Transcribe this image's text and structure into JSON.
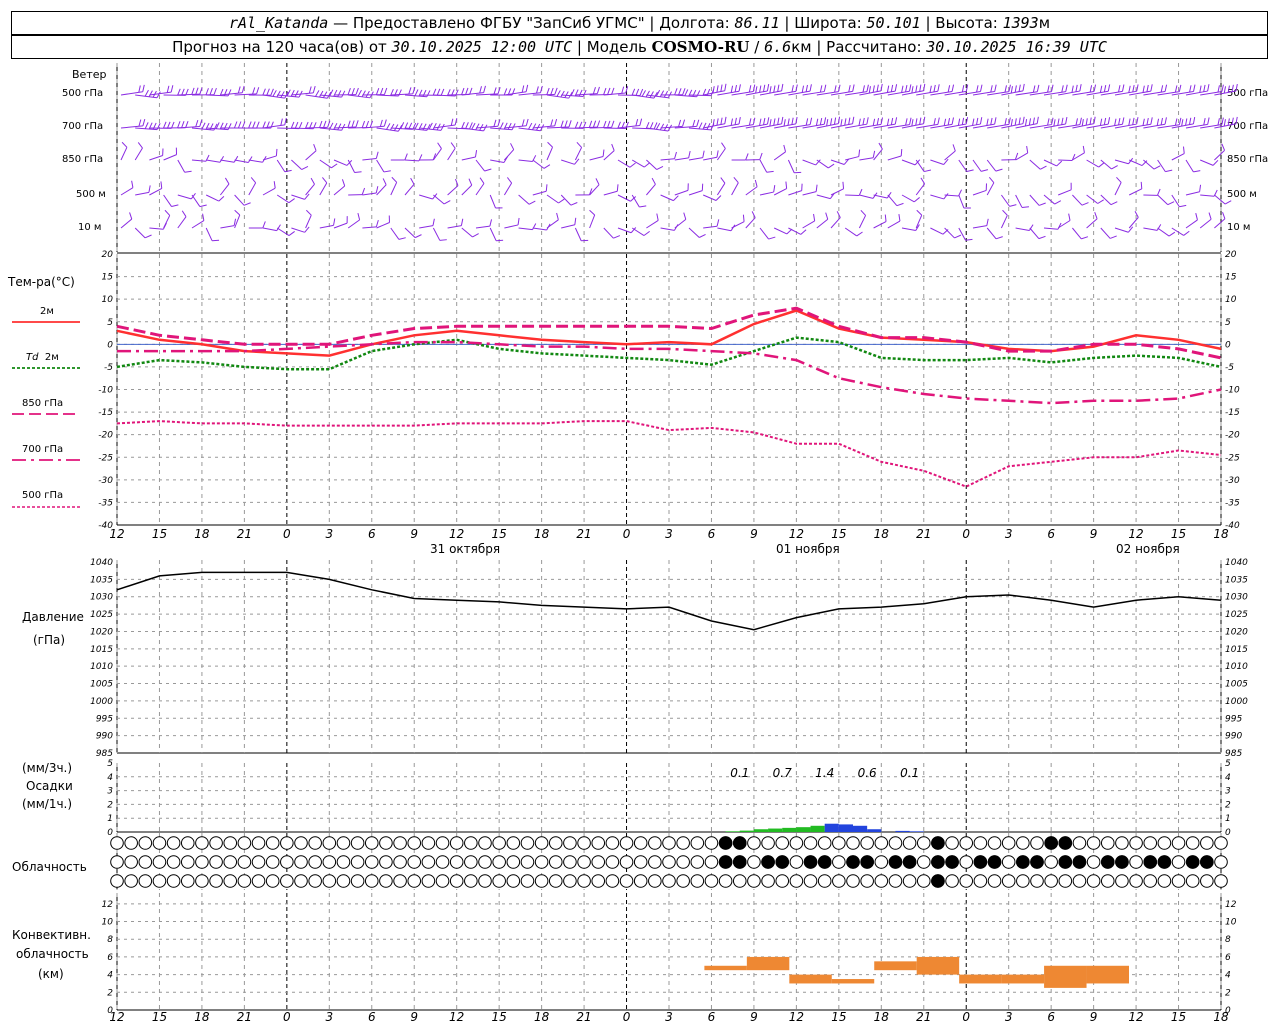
{
  "header": {
    "station": "rAl_Katanda",
    "sep1": " — Предоставлено ФГБУ \"ЗапСиб УГМС\" | Долгота: ",
    "lon": "86.11",
    "sep2": " | Широта: ",
    "lat": "50.101",
    "sep3": " | Высота: ",
    "alt": "1393",
    "alt_unit": "м",
    "line2_a": "Прогноз на 120 часа(ов) от ",
    "issued": "30.10.2025 12:00 UTC",
    "line2_b": "  | Модель ",
    "model": "COSMO-RU",
    "line2_c": " / ",
    "resolution": "6.6",
    "res_unit": "км",
    "line2_d": " | Рассчитано: ",
    "calculated": "30.10.2025 16:39 UTC"
  },
  "colors": {
    "wind": "#8a2be2",
    "t2m": "#ff3030",
    "td2m": "#118811",
    "t850": "#e0157a",
    "t700": "#e0157a",
    "t500": "#e0157a",
    "pressure": "#000000",
    "precip_green": "#22bb22",
    "precip_blue": "#2244dd",
    "convective": "#ee8833",
    "grid": "#999999"
  },
  "labels": {
    "wind": "Ветер",
    "wind_levels": [
      "500 гПа",
      "700 гПа",
      "850 гПа",
      "500 м",
      "10  м"
    ],
    "temp": "Тем-ра(°C)",
    "legend_2m": "2м",
    "legend_td_a": "Td",
    "legend_td_b": "2м",
    "legend_850": "850 гПа",
    "legend_700": "700 гПа",
    "legend_500": "500 гПа",
    "pressure_a": "Давление",
    "pressure_b": "(гПа)",
    "precip_a": "(мм/3ч.)",
    "precip_b": "Осадки",
    "precip_c": "(мм/1ч.)",
    "cloud": "Облачность",
    "conv_a": "Конвективн.",
    "conv_b": "облачность",
    "conv_c": "(км)",
    "dates": [
      "31 октября",
      "01 ноября",
      "02 ноября"
    ]
  },
  "time_axis": {
    "hours_from_start": [
      0,
      3,
      6,
      9,
      12,
      15,
      18,
      21,
      24,
      27,
      30,
      33,
      36,
      39,
      42,
      45,
      48,
      51,
      54,
      57,
      60,
      63,
      66,
      69,
      72,
      75,
      78
    ],
    "tick_labels": [
      "12",
      "15",
      "18",
      "21",
      "0",
      "3",
      "6",
      "9",
      "12",
      "15",
      "18",
      "21",
      "0",
      "3",
      "6",
      "9",
      "12",
      "15",
      "18",
      "21",
      "0",
      "3",
      "6",
      "9",
      "12",
      "15",
      "18"
    ]
  },
  "chart_data": [
    {
      "type": "line",
      "title": "Тем-ра(°C)",
      "x_unit": "hours from 30.10.2025 12:00 UTC",
      "ylim": [
        -40,
        20
      ],
      "yticks": [
        -40,
        -35,
        -30,
        -25,
        -20,
        -15,
        -10,
        -5,
        0,
        5,
        10,
        15,
        20
      ],
      "series": [
        {
          "name": "2м",
          "x": [
            0,
            3,
            6,
            9,
            12,
            15,
            18,
            21,
            24,
            27,
            30,
            33,
            36,
            39,
            42,
            45,
            48,
            51,
            54,
            57,
            60,
            63,
            66,
            69,
            72,
            75,
            78
          ],
          "values": [
            3,
            1,
            0,
            -1.5,
            -2,
            -2.5,
            0,
            2,
            3,
            2,
            1,
            0.5,
            0,
            0.5,
            0,
            4.5,
            7.5,
            3.5,
            1.5,
            1,
            0.5,
            -1,
            -1.5,
            -0.5,
            2,
            1,
            -1
          ]
        },
        {
          "name": "Td 2м",
          "x": [
            0,
            3,
            6,
            9,
            12,
            15,
            18,
            21,
            24,
            27,
            30,
            33,
            36,
            39,
            42,
            45,
            48,
            51,
            54,
            57,
            60,
            63,
            66,
            69,
            72,
            75,
            78
          ],
          "values": [
            -5,
            -3.5,
            -4,
            -5,
            -5.5,
            -5.5,
            -1.5,
            0,
            1,
            -1,
            -2,
            -2.5,
            -3,
            -3.5,
            -4.5,
            -1.5,
            1.5,
            0.5,
            -3,
            -3.5,
            -3.5,
            -3,
            -4,
            -3,
            -2.5,
            -3,
            -5
          ]
        },
        {
          "name": "850 гПа",
          "x": [
            0,
            3,
            6,
            9,
            12,
            15,
            18,
            21,
            24,
            27,
            30,
            33,
            36,
            39,
            42,
            45,
            48,
            51,
            54,
            57,
            60,
            63,
            66,
            69,
            72,
            75,
            78
          ],
          "values": [
            4,
            2,
            1,
            0,
            0,
            0,
            2,
            3.5,
            4,
            4,
            4,
            4,
            4,
            4,
            3.5,
            6.5,
            8,
            4,
            1.5,
            1.5,
            0.5,
            -1.5,
            -1.5,
            0,
            0,
            -1,
            -3
          ]
        },
        {
          "name": "700 гПа",
          "x": [
            0,
            3,
            6,
            9,
            12,
            15,
            18,
            21,
            24,
            27,
            30,
            33,
            36,
            39,
            42,
            45,
            48,
            51,
            54,
            57,
            60,
            63,
            66,
            69,
            72,
            75,
            78
          ],
          "values": [
            -1.5,
            -1.5,
            -1.5,
            -1.5,
            -1,
            -0.5,
            0,
            0.5,
            0.5,
            0,
            -0.5,
            -0.5,
            -1,
            -1,
            -1.5,
            -2,
            -3.5,
            -7.5,
            -9.5,
            -11,
            -12,
            -12.5,
            -13,
            -12.5,
            -12.5,
            -12,
            -10
          ]
        },
        {
          "name": "500 гПа",
          "x": [
            0,
            3,
            6,
            9,
            12,
            15,
            18,
            21,
            24,
            27,
            30,
            33,
            36,
            39,
            42,
            45,
            48,
            51,
            54,
            57,
            60,
            63,
            66,
            69,
            72,
            75,
            78
          ],
          "values": [
            -17.5,
            -17,
            -17.5,
            -17.5,
            -18,
            -18,
            -18,
            -18,
            -17.5,
            -17.5,
            -17.5,
            -17,
            -17,
            -19,
            -18.5,
            -19.5,
            -22,
            -22,
            -26,
            -28,
            -31.5,
            -27,
            -26,
            -25,
            -25,
            -23.5,
            -24.5
          ]
        }
      ]
    },
    {
      "type": "line",
      "title": "Давление (гПа)",
      "ylim": [
        985,
        1040
      ],
      "yticks": [
        985,
        990,
        995,
        1000,
        1005,
        1010,
        1015,
        1020,
        1025,
        1030,
        1035,
        1040
      ],
      "series": [
        {
          "name": "Давление",
          "x": [
            0,
            3,
            6,
            9,
            12,
            15,
            18,
            21,
            24,
            27,
            30,
            33,
            36,
            39,
            42,
            45,
            48,
            51,
            54,
            57,
            60,
            63,
            66,
            69,
            72,
            75,
            78
          ],
          "values": [
            1032,
            1036,
            1037,
            1037,
            1037,
            1035,
            1032,
            1029.5,
            1029,
            1028.5,
            1027.5,
            1027,
            1026.5,
            1027,
            1023,
            1020.5,
            1024,
            1026.5,
            1027,
            1028,
            1030,
            1030.5,
            1029,
            1027,
            1029,
            1030,
            1029
          ]
        }
      ]
    },
    {
      "type": "bar",
      "title": "Осадки (мм/3ч.) (мм/1ч.)",
      "ylim": [
        0,
        5
      ],
      "yticks": [
        0,
        1,
        2,
        3,
        4,
        5
      ],
      "three_hour_labels": [
        "0.1",
        "0.7",
        "1.4",
        "0.6",
        "0.1"
      ],
      "three_hour_label_x": [
        44,
        47,
        50,
        53,
        56
      ],
      "series": [
        {
          "name": "мм/1ч. (зелёный)",
          "x": [
            43.5,
            44.5,
            45.5,
            46.5,
            47.5,
            48.5,
            49.5
          ],
          "values": [
            0.05,
            0.1,
            0.2,
            0.25,
            0.3,
            0.35,
            0.45
          ]
        },
        {
          "name": "мм/1ч. (синий)",
          "x": [
            50.5,
            51.5,
            52.5,
            53.5,
            55.5,
            56.5
          ],
          "values": [
            0.6,
            0.55,
            0.45,
            0.2,
            0.08,
            0.05
          ]
        }
      ]
    },
    {
      "type": "bar",
      "title": "Конвективн. облачность (км)",
      "ylim": [
        0,
        13
      ],
      "yticks": [
        0,
        2,
        4,
        6,
        8,
        10,
        12
      ],
      "series": [
        {
          "name": "Конвективная облачность",
          "x": [
            43,
            46,
            49,
            52,
            55,
            58,
            61,
            64,
            67,
            70
          ],
          "bottom": [
            4.5,
            4.5,
            3,
            3,
            4.5,
            4,
            3,
            3,
            2.5,
            3
          ],
          "top": [
            5,
            6,
            4,
            3.5,
            5.5,
            6,
            4,
            4,
            5,
            5
          ]
        }
      ]
    }
  ]
}
